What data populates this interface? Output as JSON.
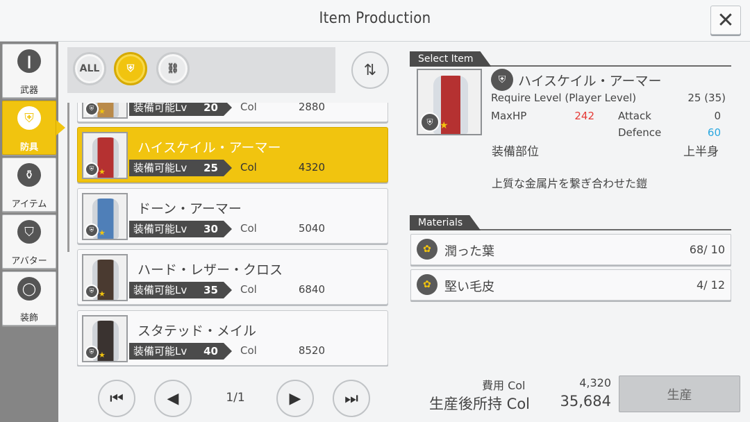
{
  "header": {
    "title": "Item Production",
    "close_glyph": "✕"
  },
  "categories": [
    {
      "label": "武器",
      "icon": "sword-icon",
      "glyph": "❙",
      "active": false
    },
    {
      "label": "防具",
      "icon": "armor-icon",
      "glyph": "⛨",
      "active": true
    },
    {
      "label": "アイテム",
      "icon": "potion-icon",
      "glyph": "⚱",
      "active": false
    },
    {
      "label": "アバター",
      "icon": "coat-icon",
      "glyph": "⛉",
      "active": false
    },
    {
      "label": "装飾",
      "icon": "necklace-icon",
      "glyph": "◯",
      "active": false
    }
  ],
  "filters": [
    {
      "label": "ALL",
      "icon": "all-filter-icon",
      "active": false
    },
    {
      "label": "⛨",
      "icon": "upper-body-filter-icon",
      "active": true
    },
    {
      "label": "⛓",
      "icon": "lower-body-filter-icon",
      "active": false
    }
  ],
  "sort_glyph": "⇅",
  "list": {
    "col_label": "Col",
    "level_prefix": "装備可能Lv",
    "items": [
      {
        "name": "",
        "level": "20",
        "col": "2880",
        "color": "#b98a4a"
      },
      {
        "name": "ハイスケイル・アーマー",
        "level": "25",
        "col": "4320",
        "color": "#b53131",
        "selected": true
      },
      {
        "name": "ドーン・アーマー",
        "level": "30",
        "col": "5040",
        "color": "#4f7fb8"
      },
      {
        "name": "ハード・レザー・クロス",
        "level": "35",
        "col": "6840",
        "color": "#4a3a30"
      },
      {
        "name": "スタテッド・メイル",
        "level": "40",
        "col": "8520",
        "color": "#3a3330"
      }
    ]
  },
  "pager": {
    "page": "1/1",
    "first": "⏮",
    "prev": "◀",
    "next": "▶",
    "last": "⏭"
  },
  "detail": {
    "section_label": "Select Item",
    "name": "ハイスケイル・アーマー",
    "require_label": "Require Level (Player Level)",
    "require_value": "25 (35)",
    "maxhp_label": "MaxHP",
    "maxhp_value": "242",
    "attack_label": "Attack",
    "attack_value": "0",
    "defence_label": "Defence",
    "defence_value": "60",
    "slot_label": "装備部位",
    "slot_value": "上半身",
    "description": "上質な金属片を繋ぎ合わせた鎧"
  },
  "materials": {
    "section_label": "Materials",
    "items": [
      {
        "name": "潤った葉",
        "count": "68/ 10",
        "short": false
      },
      {
        "name": "堅い毛皮",
        "count": "4/ 12",
        "short": true
      }
    ]
  },
  "footer": {
    "cost_label": "費用 Col",
    "cost_value": "4,320",
    "after_label": "生産後所持 Col",
    "after_value": "35,684",
    "produce_label": "生産"
  },
  "colors": {
    "accent": "#f1c40f",
    "sidebar": "#858585",
    "deficit": "#e53935",
    "bonus": "#29a7df"
  }
}
